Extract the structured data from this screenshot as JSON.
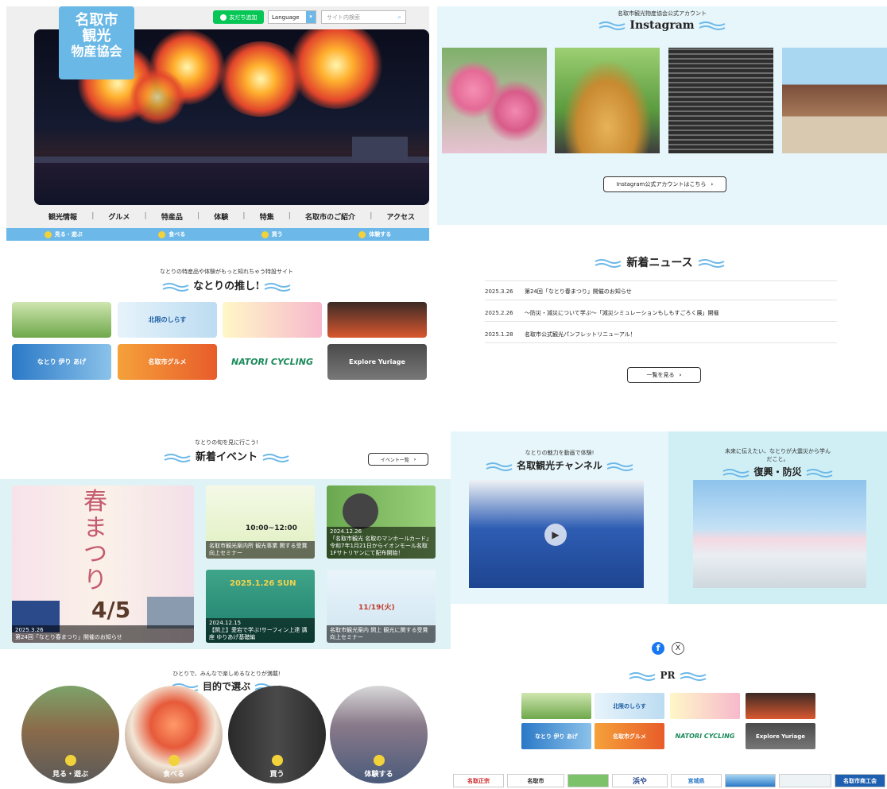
{
  "header": {
    "logo_lines": [
      "名取市",
      "観光",
      "物産協会"
    ],
    "line_button": "友だち追加",
    "language_label": "Language",
    "search_placeholder": "サイト内検索"
  },
  "nav": {
    "items": [
      "観光情報",
      "グルメ",
      "特産品",
      "体験",
      "特集",
      "名取市のご紹介",
      "アクセス"
    ],
    "sub": [
      "見る・遊ぶ",
      "食べる",
      "買う",
      "体験する"
    ]
  },
  "instagram": {
    "subtitle": "名取市観光物産協会公式アカウント",
    "title": "Instagram",
    "button": "Instagram公式アカウントはこちら"
  },
  "oshi": {
    "subtitle": "なとりの特産品や体験がもっと知れちゃう特設サイト",
    "title": "なとりの推し!",
    "tiles": [
      "",
      "北限のしらす",
      "",
      "",
      "なとり 伊り あげ",
      "名取市グルメ",
      "NATORI CYCLING",
      "Explore Yuriage"
    ]
  },
  "news": {
    "title": "新着ニュース",
    "items": [
      {
        "date": "2025.3.26",
        "text": "第24回「なとり春まつり」開催のお知らせ"
      },
      {
        "date": "2025.2.26",
        "text": "～防災・減災について学ぶ～「減災シミュレーションもしもすごろく展」開催"
      },
      {
        "date": "2025.1.28",
        "text": "名取市公式観光パンフレットリニューアル！"
      }
    ],
    "button": "一覧を見る"
  },
  "events": {
    "subtitle": "なとりの旬を見に行こう!",
    "title": "新着イベント",
    "button": "イベント一覧",
    "main_date": "2025.3.26",
    "main_title": "第24回「なとり春まつり」開催のお知らせ",
    "main_poster": "春まつり",
    "main_day": "4/5",
    "cards": [
      {
        "date": "",
        "caption": "名取市観光案内所 観光事業 関する受賞 向上セミナー",
        "highlight": "10:00~12:00"
      },
      {
        "date": "2024.12.26",
        "caption": "「名取市観光 名取のマンホールカード」令和7年1月21日からイオンモール名取1Fサトリヤンにて配布開始！",
        "highlight": ""
      },
      {
        "date": "2024.12.15",
        "caption": "【閖上】愛宕で学ぶ!サーフィン上達 講座 ゆりあげ基礎編",
        "highlight": "2025.1.26 SUN"
      },
      {
        "date": "",
        "caption": "名取市観光案内 閖上 観光に関する受賞 向上セミナー",
        "highlight": "11/19(火)"
      }
    ]
  },
  "channel": {
    "subtitle": "なとりの魅力を動画で体験!",
    "title": "名取観光チャンネル"
  },
  "fukko": {
    "subtitle": "未来に伝えたい、なとりが大震災から学んだこと。",
    "title": "復興・防災"
  },
  "purpose": {
    "subtitle": "ひとりで、みんなで楽しめるなとりが満載!",
    "title": "目的で選ぶ",
    "items": [
      "見る・遊ぶ",
      "食べる",
      "買う",
      "体験する"
    ]
  },
  "pr": {
    "title": "PR",
    "tiles": [
      "",
      "北限のしらす",
      "",
      "",
      "なとり 伊り あげ",
      "名取市グルメ",
      "NATORI CYCLING",
      "Explore Yuriage"
    ],
    "banners": [
      "名取正宗",
      "名取市",
      "",
      "浜や",
      "宮城県",
      "",
      "",
      "名取市商工会"
    ]
  },
  "colors": {
    "accent": "#6cb8e8",
    "light_bg": "#e7f6fb",
    "line_green": "#06c755"
  }
}
